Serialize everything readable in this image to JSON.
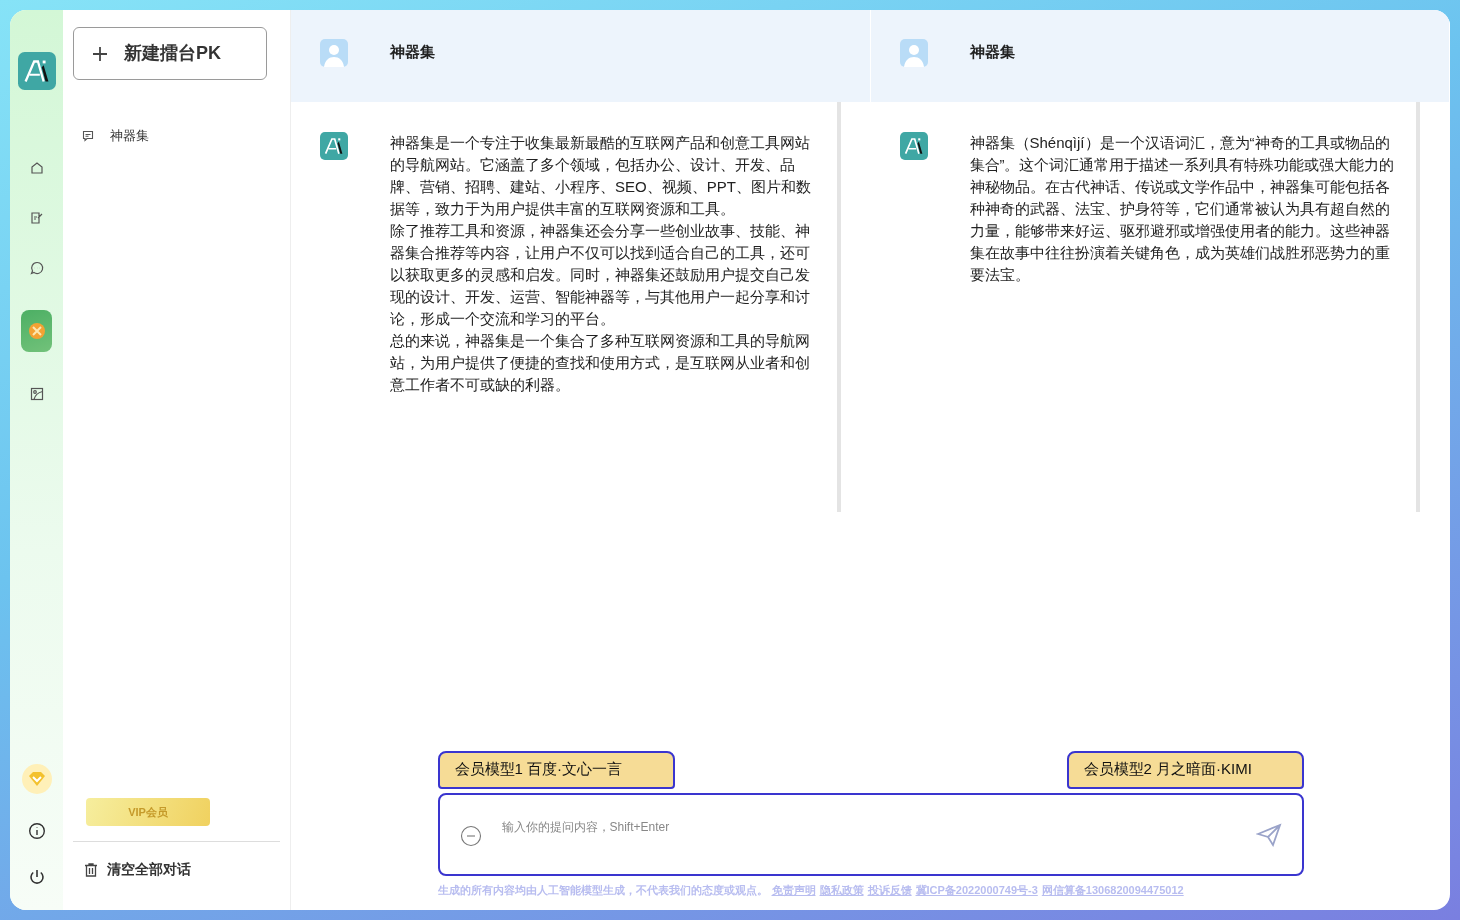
{
  "rail": {
    "items": [
      {
        "kind": "home",
        "selected": false
      },
      {
        "kind": "edit",
        "selected": false
      },
      {
        "kind": "chat",
        "selected": false
      },
      {
        "kind": "pk",
        "selected": true
      },
      {
        "kind": "image",
        "selected": false
      }
    ],
    "bottom": [
      {
        "kind": "vip"
      },
      {
        "kind": "info"
      },
      {
        "kind": "power"
      }
    ]
  },
  "sidebar": {
    "new_button": "新建擂台PK",
    "conversations": [
      {
        "title": "神器集"
      }
    ],
    "vip_button": "VIP会员",
    "clear_button": "清空全部对话"
  },
  "panels": [
    {
      "title": "神器集",
      "answer": [
        "神器集是一个专注于收集最新最酷的互联网产品和创意工具网站的导航网站。它涵盖了多个领域，包括办公、设计、开发、品牌、营销、招聘、建站、小程序、SEO、视频、PPT、图片和数据等，致力于为用户提供丰富的互联网资源和工具。",
        "除了推荐工具和资源，神器集还会分享一些创业故事、技能、神器集合推荐等内容，让用户不仅可以找到适合自己的工具，还可以获取更多的灵感和启发。同时，神器集还鼓励用户提交自己发现的设计、开发、运营、智能神器等，与其他用户一起分享和讨论，形成一个交流和学习的平台。",
        "总的来说，神器集是一个集合了多种互联网资源和工具的导航网站，为用户提供了便捷的查找和使用方式，是互联网从业者和创意工作者不可或缺的利器。"
      ]
    },
    {
      "title": "神器集",
      "answer": [
        "神器集（Shénqìjí）是一个汉语词汇，意为“神奇的工具或物品的集合”。这个词汇通常用于描述一系列具有特殊功能或强大能力的神秘物品。在古代神话、传说或文学作品中，神器集可能包括各种神奇的武器、法宝、护身符等，它们通常被认为具有超自然的力量，能够带来好运、驱邪避邪或增强使用者的能力。这些神器集在故事中往往扮演着关键角色，成为英雄们战胜邪恶势力的重要法宝。"
      ]
    }
  ],
  "model_tabs": [
    {
      "label": "会员模型1 百度·文心一言"
    },
    {
      "label": "会员模型2 月之暗面·KIMI"
    }
  ],
  "input": {
    "placeholder": "输入你的提问内容，Shift+Enter"
  },
  "footer": {
    "text": "生成的所有内容均由人工智能模型生成，不代表我们的态度或观点。",
    "links": [
      "免责声明",
      "隐私政策",
      "投诉反馈",
      "冀ICP备2022000749号-3",
      "网信算备1306820094475012"
    ]
  }
}
